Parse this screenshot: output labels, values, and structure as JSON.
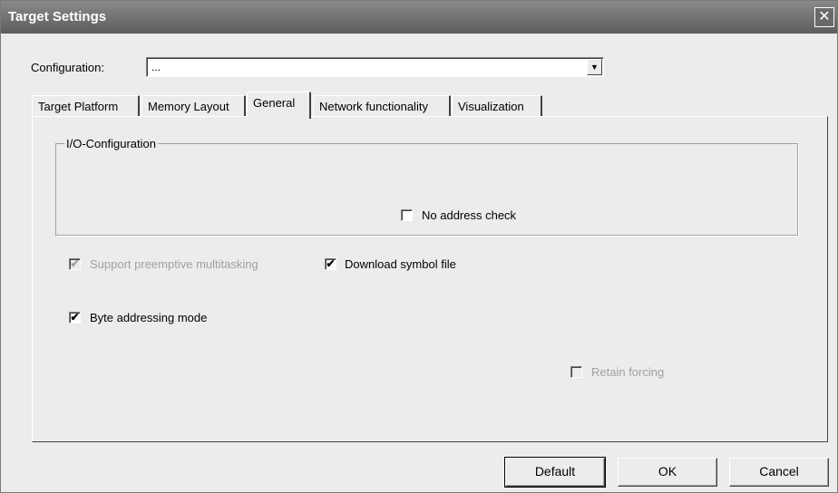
{
  "window": {
    "title": "Target Settings",
    "close_glyph": "✕"
  },
  "configuration": {
    "label": "Configuration:",
    "value": "...",
    "arrow_glyph": "▼"
  },
  "tabs": [
    {
      "label": "Target Platform",
      "active": false
    },
    {
      "label": "Memory Layout",
      "active": false
    },
    {
      "label": "General",
      "active": true
    },
    {
      "label": "Network functionality",
      "active": false
    },
    {
      "label": "Visualization",
      "active": false
    }
  ],
  "general": {
    "io_group_label": "I/O-Configuration",
    "no_address_check": {
      "label": "No address check",
      "checked": false,
      "enabled": true
    },
    "support_preemptive": {
      "label": "Support preemptive multitasking",
      "checked": true,
      "enabled": false
    },
    "download_symbol_file": {
      "label": "Download symbol file",
      "checked": true,
      "enabled": true
    },
    "byte_addressing": {
      "label": "Byte addressing mode",
      "checked": true,
      "enabled": true
    },
    "retain_forcing": {
      "label": "Retain forcing",
      "checked": false,
      "enabled": false
    }
  },
  "buttons": {
    "default": "Default",
    "ok": "OK",
    "cancel": "Cancel"
  },
  "check_glyph": "✔",
  "icons": {
    "close": "close-icon",
    "dropdown": "chevron-down-icon"
  },
  "colors": {
    "titlebar": "#6e6e6e",
    "dialog_bg": "#ececec",
    "disabled_text": "#a0a0a0"
  }
}
